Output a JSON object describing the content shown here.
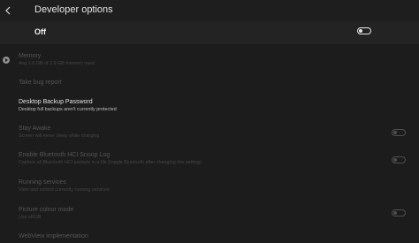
{
  "header": {
    "back_label": "<",
    "title": "Developer options"
  },
  "master_switch": {
    "label": "Off",
    "state": "off"
  },
  "settings": {
    "memory": {
      "title": "Memory",
      "subtitle": "Avg 1.6 GB of 2.9 GB memory used"
    },
    "bug_report": {
      "title": "Take bug report"
    },
    "backup_password": {
      "title": "Desktop Backup Password",
      "subtitle": "Desktop full backups aren't currently protected"
    },
    "stay_awake": {
      "title": "Stay Awake",
      "subtitle": "Screen will never sleep while charging",
      "state": "off"
    },
    "hci_snoop": {
      "title": "Enable Bluetooth HCI Snoop Log",
      "subtitle": "Capture all Bluetooth HCI packets in a file (toggle Bluetooth after changing this setting)",
      "state": "off"
    },
    "running_services": {
      "title": "Running services",
      "subtitle": "View and control currently running services"
    },
    "colour_mode": {
      "title": "Picture colour mode",
      "subtitle": "Use sRGB",
      "state": "off"
    },
    "webview": {
      "title": "WebView implementation"
    }
  },
  "colors": {
    "background": "#1c1c1c",
    "text_enabled": "#e2e2e2",
    "text_disabled": "#555555"
  },
  "icons": {
    "back": "chevron-left-icon",
    "memory": "info-circle-icon"
  }
}
